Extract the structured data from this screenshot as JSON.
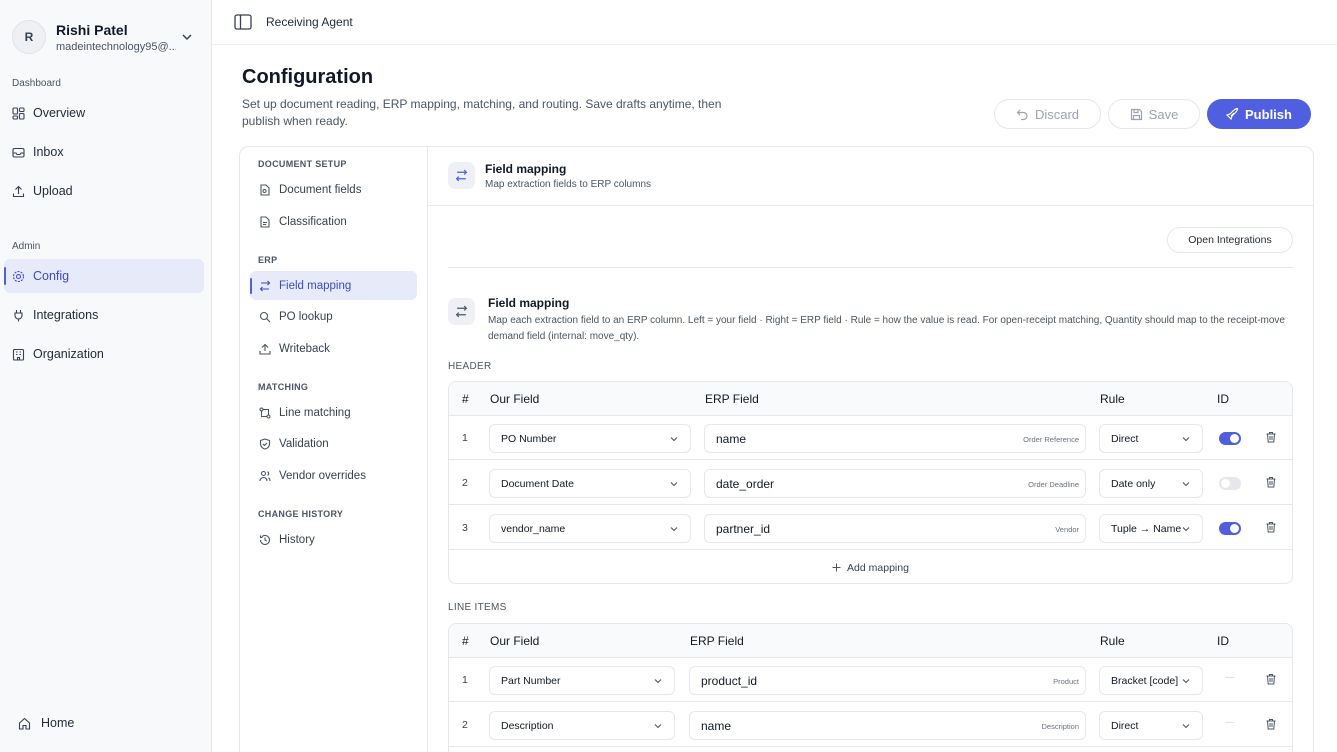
{
  "user": {
    "initial": "R",
    "name": "Rishi Patel",
    "email": "madeintechnology95@..."
  },
  "sidebar": {
    "dashboard_label": "Dashboard",
    "dashboard_items": [
      "Overview",
      "Inbox",
      "Upload"
    ],
    "admin_label": "Admin",
    "admin_items": [
      "Config",
      "Integrations",
      "Organization"
    ],
    "home": "Home"
  },
  "topbar": {
    "title": "Receiving Agent"
  },
  "page": {
    "title": "Configuration",
    "subtitle": "Set up document reading, ERP mapping, matching, and routing. Save drafts anytime, then publish when ready.",
    "discard": "Discard",
    "save": "Save",
    "publish": "Publish"
  },
  "subnav": {
    "document_setup": {
      "label": "DOCUMENT SETUP",
      "items": [
        "Document fields",
        "Classification"
      ]
    },
    "erp": {
      "label": "ERP",
      "items": [
        "Field mapping",
        "PO lookup",
        "Writeback"
      ]
    },
    "matching": {
      "label": "MATCHING",
      "items": [
        "Line matching",
        "Validation",
        "Vendor overrides"
      ]
    },
    "history": {
      "label": "CHANGE HISTORY",
      "items": [
        "History"
      ]
    }
  },
  "content": {
    "title": "Field mapping",
    "subtitle": "Map extraction fields to ERP columns",
    "open_integrations": "Open Integrations",
    "section_title": "Field mapping",
    "section_desc": "Map each extraction field to an ERP column. Left = your field · Right = ERP field · Rule = how the value is read. For open-receipt matching, Quantity should map to the receipt-move demand field (internal: move_qty)."
  },
  "header_table": {
    "label": "HEADER",
    "columns": {
      "num": "#",
      "our": "Our Field",
      "erp": "ERP Field",
      "rule": "Rule",
      "id": "ID"
    },
    "rows": [
      {
        "num": "1",
        "our": "PO Number",
        "erp": "name",
        "hint": "Order Reference",
        "rule": "Direct",
        "id": true
      },
      {
        "num": "2",
        "our": "Document Date",
        "erp": "date_order",
        "hint": "Order Deadline",
        "rule": "Date only",
        "id": false
      },
      {
        "num": "3",
        "our": "vendor_name",
        "erp": "partner_id",
        "hint": "Vendor",
        "rule": "Tuple → Name",
        "id": true
      }
    ],
    "add": "Add mapping"
  },
  "line_table": {
    "label": "LINE ITEMS",
    "columns": {
      "num": "#",
      "our": "Our Field",
      "erp": "ERP Field",
      "rule": "Rule",
      "id": "ID"
    },
    "rows": [
      {
        "num": "1",
        "our": "Part Number",
        "erp": "product_id",
        "hint": "Product",
        "rule": "Bracket [code]",
        "id": "—"
      },
      {
        "num": "2",
        "our": "Description",
        "erp": "name",
        "hint": "Description",
        "rule": "Direct",
        "id": "—"
      }
    ]
  },
  "colors": {
    "accent": "#4f5fe0",
    "active_bg": "#e7eaf8"
  }
}
